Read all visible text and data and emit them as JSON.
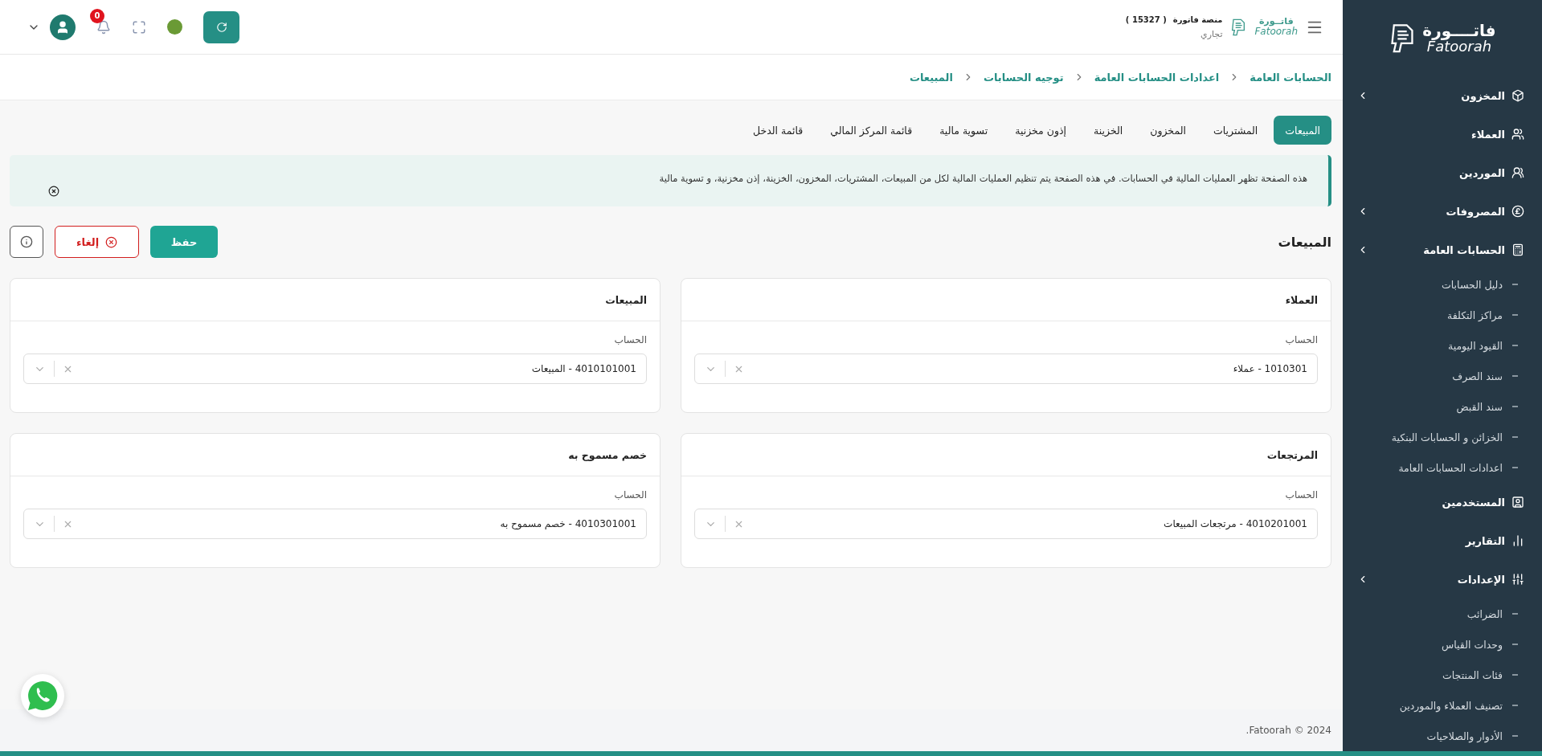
{
  "topbar": {
    "notifications": "0",
    "platform": "منصة فاتورة",
    "account_number": "( 15327 )",
    "account_type": "تجاري",
    "logo": {
      "arabic": "فاتــورة",
      "latin": "Fatoorah"
    }
  },
  "breadcrumb": [
    "الحسابات العامة",
    "اعدادات الحسابات العامة",
    "توجيه الحسابات",
    "المبيعات"
  ],
  "tabs": [
    {
      "label": "المبيعات",
      "selected": true
    },
    {
      "label": "المشتريات",
      "selected": false
    },
    {
      "label": "المخزون",
      "selected": false
    },
    {
      "label": "الخزينة",
      "selected": false
    },
    {
      "label": "إذون مخزنية",
      "selected": false
    },
    {
      "label": "تسوية مالية",
      "selected": false
    },
    {
      "label": "قائمة المركز المالي",
      "selected": false
    },
    {
      "label": "قائمة الدخل",
      "selected": false
    }
  ],
  "alert": {
    "text": "هذه الصفحة تظهر العمليات المالية في الحسابات. في هذه الصفحة يتم تنظيم العمليات المالية لكل من المبيعات، المشتريات، المخزون، الخزينة، إذن مخزنية، و تسوية مالية"
  },
  "section": {
    "title": "المبيعات",
    "buttons": [
      {
        "kind": "save",
        "label": "حفظ"
      },
      {
        "kind": "cancel",
        "label": "إلغاء"
      },
      {
        "kind": "info"
      }
    ]
  },
  "cards": [
    {
      "title": "العملاء",
      "field_label": "الحساب",
      "value": "1010301 - عملاء"
    },
    {
      "title": "المبيعات",
      "field_label": "الحساب",
      "value": "4010101001 - المبيعات"
    },
    {
      "title": "المرتجعات",
      "field_label": "الحساب",
      "value": "4010201001 - مرتجعات المبيعات"
    },
    {
      "title": "خصم مسموح به",
      "field_label": "الحساب",
      "value": "4010301001 - خصم مسموح به"
    }
  ],
  "footer": "Fatoorah © 2024.",
  "sidebar": {
    "logo": {
      "arabic": "فاتــــورة",
      "latin": "Fatoorah"
    },
    "items": [
      {
        "label": "المخزون",
        "expandable": true
      },
      {
        "label": "العملاء",
        "expandable": false
      },
      {
        "label": "الموردين",
        "expandable": false
      },
      {
        "label": "المصروفات",
        "expandable": true
      },
      {
        "label": "الحسابات العامة",
        "expandable": true,
        "children": [
          {
            "label": "دليل الحسابات"
          },
          {
            "label": "مراكز التكلفة"
          },
          {
            "label": "القيود اليومية"
          },
          {
            "label": "سند الصرف"
          },
          {
            "label": "سند القبض"
          },
          {
            "label": "الخزائن و الحسابات البنكية"
          },
          {
            "label": "اعدادات الحسابات العامة"
          }
        ]
      },
      {
        "label": "المستخدمين",
        "expandable": false
      },
      {
        "label": "التقارير",
        "expandable": false
      },
      {
        "label": "الإعدادات",
        "expandable": true,
        "children": [
          {
            "label": "الضرائب"
          },
          {
            "label": "وحدات القياس"
          },
          {
            "label": "فئات المنتجات"
          },
          {
            "label": "تصنيف العملاء والموردين"
          },
          {
            "label": "الأدوار والصلاحيات"
          }
        ]
      }
    ]
  }
}
